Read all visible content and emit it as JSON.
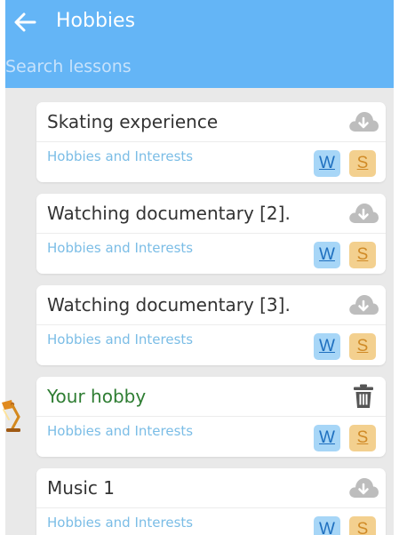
{
  "header": {
    "title": "Hobbies",
    "search_placeholder": "Search lessons",
    "search_value": ""
  },
  "lessons": [
    {
      "title": "Skating experience",
      "category": "Hobbies and Interests",
      "action_icon": "cloud-download-icon",
      "w_label": "W",
      "s_label": "S"
    },
    {
      "title": "Watching documentary [2].",
      "category": "Hobbies and Interests",
      "action_icon": "cloud-download-icon",
      "w_label": "W",
      "s_label": "S"
    },
    {
      "title": "Watching documentary [3].",
      "category": "Hobbies and Interests",
      "action_icon": "cloud-download-icon",
      "w_label": "W",
      "s_label": "S"
    },
    {
      "title": "Your hobby",
      "category": "Hobbies and Interests",
      "action_icon": "trash-icon",
      "w_label": "W",
      "s_label": "S"
    },
    {
      "title": "Music 1",
      "category": "Hobbies and Interests",
      "action_icon": "cloud-download-icon",
      "w_label": "W",
      "s_label": "S"
    }
  ],
  "colors": {
    "header": "#64b5f6",
    "background": "#e9e9e9",
    "category_text": "#7bbde6",
    "user_lesson_title": "#2e7d32",
    "badge_w": "#a7d6f7",
    "badge_s": "#f3d08f",
    "icon_gray": "#bdbdbd"
  }
}
